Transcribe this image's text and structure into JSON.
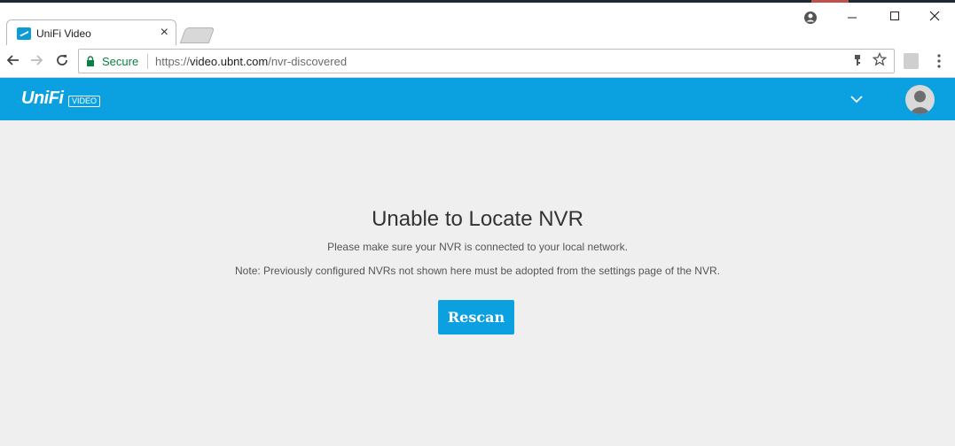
{
  "browser": {
    "tab_title": "UniFi Video",
    "tab_close": "×",
    "security_label": "Secure",
    "url_scheme": "https://",
    "url_host": "video.ubnt.com",
    "url_path": "/nvr-discovered"
  },
  "app": {
    "logo_text": "UniFi",
    "logo_badge": "VIDEO",
    "brand_color": "#0ba0e0"
  },
  "content": {
    "title": "Unable to Locate NVR",
    "message": "Please make sure your NVR is connected to your local network.",
    "note": "Note: Previously configured NVRs not shown here must be adopted from the settings page of the NVR.",
    "rescan_label": "Rescan"
  },
  "icons": {
    "back": "back-arrow-icon",
    "forward": "forward-arrow-icon",
    "reload": "reload-icon",
    "lock": "lock-icon",
    "key": "key-icon",
    "star": "star-icon",
    "menu": "kebab-menu-icon",
    "chevron": "chevron-down-icon",
    "avatar": "user-avatar-icon"
  }
}
